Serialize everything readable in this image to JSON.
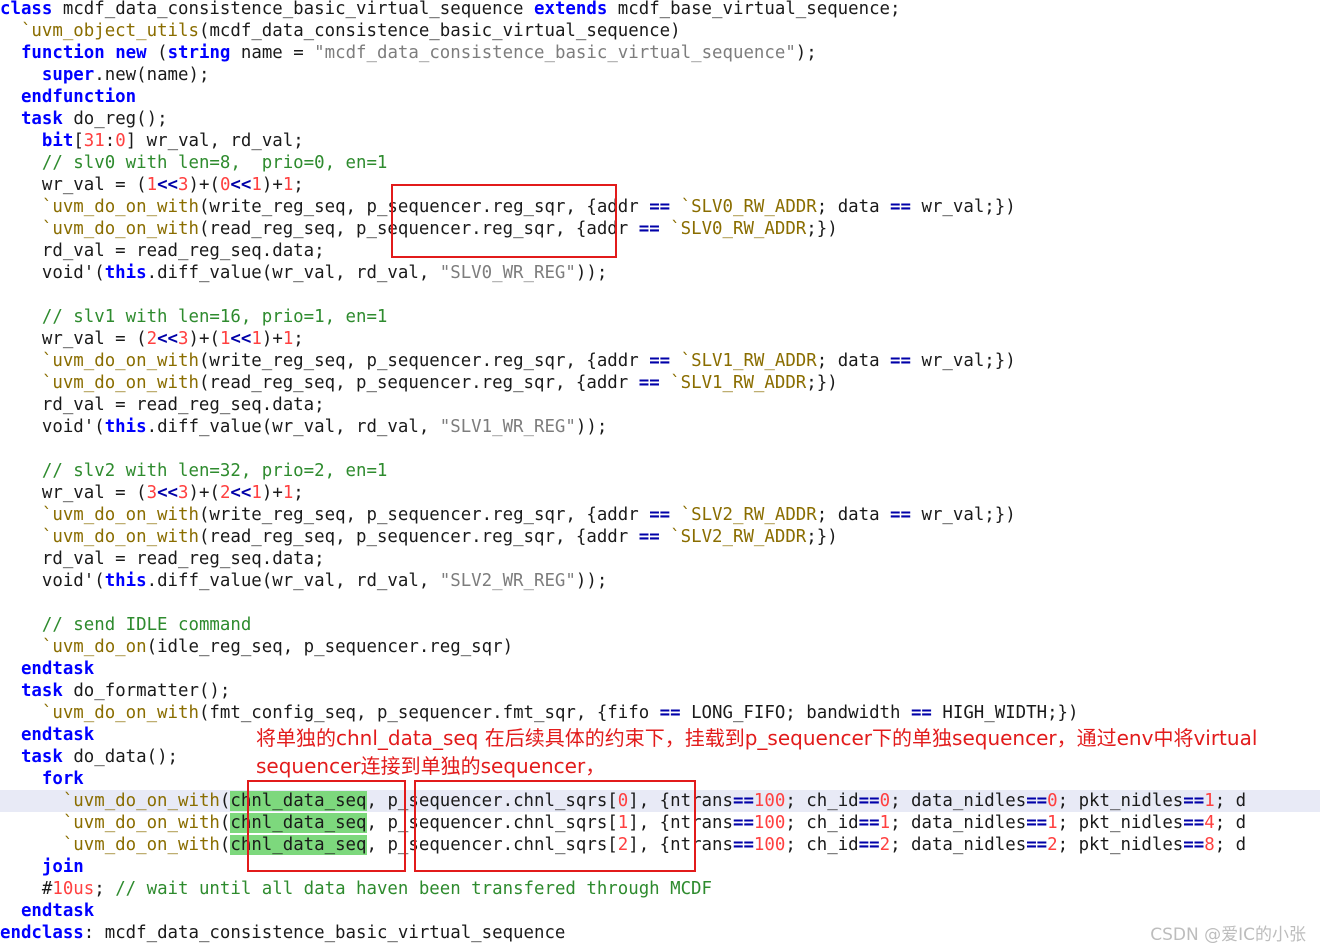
{
  "code": {
    "class_name": "mcdf_data_consistence_basic_virtual_sequence",
    "base_class": "mcdf_base_virtual_sequence",
    "object_utils_arg": "mcdf_data_consistence_basic_virtual_sequence",
    "default_name": "\"mcdf_data_consistence_basic_virtual_sequence\"",
    "reg_sqr": "p_sequencer.reg_sqr",
    "fmt_sqr": "p_sequencer.fmt_sqr",
    "chnl_seq": "chnl_data_seq",
    "comments": {
      "slv0": "// slv0 with len=8,  prio=0, en=1",
      "slv1": "// slv1 with len=16, prio=1, en=1",
      "slv2": "// slv2 with len=32, prio=2, en=1",
      "idle": "// send IDLE command",
      "wait": "// wait until all data haven been transfered through MCDF"
    },
    "regs": {
      "slv0_addr": "`SLV0_RW_ADDR",
      "slv1_addr": "`SLV1_RW_ADDR",
      "slv2_addr": "`SLV2_RW_ADDR",
      "slv0_str": "\"SLV0_WR_REG\"",
      "slv1_str": "\"SLV1_WR_REG\"",
      "slv2_str": "\"SLV2_WR_REG\""
    },
    "chnl_lines": [
      {
        "idx": "0",
        "ch_id": "0",
        "data_nidles": "0",
        "pkt_nidles": "1"
      },
      {
        "idx": "1",
        "ch_id": "1",
        "data_nidles": "1",
        "pkt_nidles": "4"
      },
      {
        "idx": "2",
        "ch_id": "2",
        "data_nidles": "2",
        "pkt_nidles": "8"
      }
    ]
  },
  "annotation": {
    "line1": "将单独的chnl_data_seq 在后续具体的约束下，挂载到p_sequencer下的单独sequencer，通过env中将virtual",
    "line2": "sequencer连接到单独的sequencer，"
  },
  "watermark": "CSDN @爱IC的小张",
  "colors": {
    "keyword": "#0000ff",
    "macro": "#8a6d00",
    "string": "#7d7d7d",
    "number": "#ff4040",
    "comment": "#2e8b2e",
    "highlight": "#7dd87d",
    "annotation": "#e21b1b"
  }
}
